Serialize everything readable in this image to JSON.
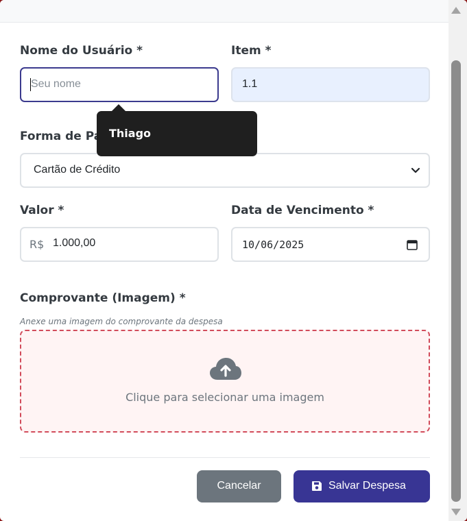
{
  "form": {
    "user_label": "Nome do Usuário *",
    "user_placeholder": "Seu nome",
    "item_label": "Item *",
    "item_value": "1.1",
    "payment_label": "Forma de Pag",
    "payment_value": "Cartão de Crédito",
    "value_label": "Valor *",
    "currency_prefix": "R$",
    "value_amount": "1.000,00",
    "due_label": "Data de Vencimento *",
    "due_value": "10/06/2025",
    "receipt_label": "Comprovante (Imagem) *",
    "receipt_hint": "Anexe uma imagem do comprovante da despesa",
    "dropzone_text": "Clique para selecionar uma imagem"
  },
  "tooltip": {
    "text": "Thiago"
  },
  "buttons": {
    "cancel": "Cancelar",
    "save": "Salvar Despesa"
  },
  "colors": {
    "primary": "#383594",
    "secondary": "#6c757d",
    "danger_border": "#d14b5a"
  },
  "icons": [
    "chevron-down-icon",
    "calendar-icon",
    "cloud-upload-icon",
    "save-icon"
  ]
}
